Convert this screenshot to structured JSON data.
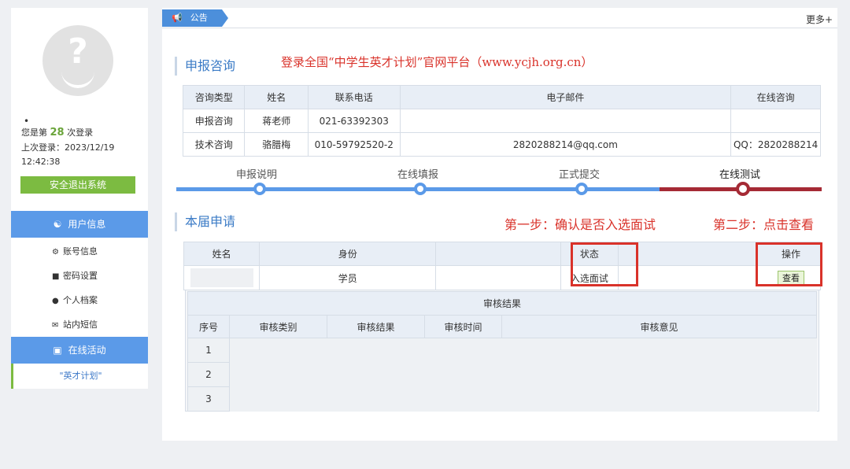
{
  "sidebar": {
    "login_prefix": "您是第",
    "login_count": "28",
    "login_suffix": "次登录",
    "last_login_label": "上次登录：2023/12/19",
    "last_login_time": "12:42:38",
    "logout_label": "安全退出系统",
    "user_menu": {
      "title": "用户信息",
      "items": [
        {
          "label": "账号信息",
          "icon": "gear-icon"
        },
        {
          "label": "密码设置",
          "icon": "lock-icon"
        },
        {
          "label": "个人档案",
          "icon": "person-icon"
        },
        {
          "label": "站内短信",
          "icon": "mail-icon"
        }
      ]
    },
    "activity_menu": {
      "title": "在线活动",
      "active_item": "\"英才计划\""
    }
  },
  "notice": {
    "label": "公告",
    "more": "更多+"
  },
  "consult": {
    "title": "申报咨询",
    "note": "登录全国“中学生英才计划”官网平台（www.ycjh.org.cn）",
    "headers": [
      "咨询类型",
      "姓名",
      "联系电话",
      "电子邮件",
      "在线咨询"
    ],
    "rows": [
      [
        "申报咨询",
        "蒋老师",
        "021-63392303",
        "",
        ""
      ],
      [
        "技术咨询",
        "骆腊梅",
        "010-59792520-2",
        "2820288214@qq.com",
        "QQ：2820288214"
      ]
    ]
  },
  "progress": {
    "steps": [
      "申报说明",
      "在线填报",
      "正式提交",
      "在线测试"
    ],
    "done_color": "#5b9ae8",
    "current_color": "#a52a35"
  },
  "apply": {
    "title": "本届申请",
    "step1_note": "第一步：确认是否入选面试",
    "step2_note": "第二步：点击查看",
    "headers": [
      "姓名",
      "身份",
      "",
      "状态",
      "操作"
    ],
    "row": {
      "identity": "学员",
      "status": "入选面试",
      "action": "查看"
    },
    "review": {
      "title": "审核结果",
      "headers": [
        "序号",
        "审核类别",
        "审核结果",
        "审核时间",
        "审核意见"
      ],
      "rows": [
        "1",
        "2",
        "3"
      ]
    }
  },
  "colors": {
    "accent": "#4c8fdb",
    "green": "#7cbb41",
    "annotation_red": "#d9322a"
  }
}
